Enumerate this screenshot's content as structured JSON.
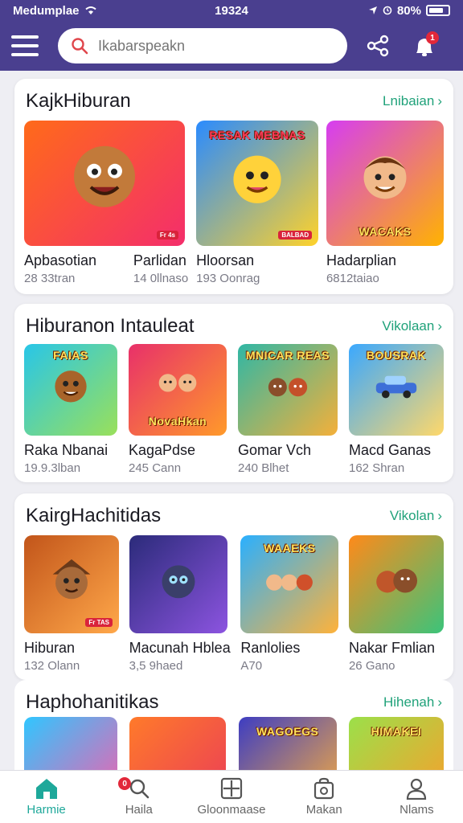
{
  "status_bar": {
    "carrier": "Medumplae",
    "time": "19324",
    "battery": "80%"
  },
  "search": {
    "placeholder": "Ikabarspeakn"
  },
  "top_bar": {
    "notification_count": "1"
  },
  "sections": [
    {
      "title": "KajkHiburan",
      "more": "Lnibaian",
      "cards": [
        {
          "name": "Apbasotian",
          "meta": "28 33tran",
          "thumb_text": "",
          "tag": "Fr 4s",
          "colors": [
            "#ff6a1a",
            "#f42e6b"
          ]
        },
        {
          "name": "Parlidan",
          "meta": "14 0llnaso",
          "thumb_text": "",
          "tag": "",
          "colors": [
            "#ff6a1a",
            "#f42e6b"
          ]
        },
        {
          "name": "Hloorsan",
          "meta": "193 Oonrag",
          "thumb_text": "RESAK MEBNAS",
          "tag": "BALBAD",
          "colors": [
            "#2a8bff",
            "#ffd22a"
          ]
        },
        {
          "name": "Hadarplian",
          "meta": "6812taiao",
          "thumb_text": "WACAKS",
          "tag": "",
          "colors": [
            "#d63df2",
            "#ffb300"
          ]
        }
      ]
    },
    {
      "title": "Hiburanon Intauleat",
      "more": "Vikolaan",
      "cards": [
        {
          "name": "Raka Nbanai",
          "meta": "19.9.3lban",
          "thumb_text": "FAIAS",
          "tag": "",
          "colors": [
            "#28c6e8",
            "#9ae05a"
          ]
        },
        {
          "name": "KagaPdse",
          "meta": "245 Cann",
          "thumb_text": "NovaHkan",
          "tag": "",
          "colors": [
            "#e8306a",
            "#ff9a2a"
          ]
        },
        {
          "name": "Gomar Vch",
          "meta": "240 Blhet",
          "thumb_text": "MNICAR REAS",
          "tag": "",
          "colors": [
            "#2fb7a5",
            "#f4b03a"
          ]
        },
        {
          "name": "Macd Ganas",
          "meta": "162 Shran",
          "thumb_text": "BOUSRAK",
          "tag": "",
          "colors": [
            "#3aa8ff",
            "#ffd86a"
          ]
        }
      ]
    },
    {
      "title": "KairgHachitidas",
      "more": "Vikolan",
      "cards": [
        {
          "name": "Hiburan",
          "meta": "132 Olann",
          "thumb_text": "",
          "tag": "Fr TAS",
          "colors": [
            "#c2551a",
            "#ffa84a"
          ]
        },
        {
          "name": "Macunah Hblea",
          "meta": "3,5 9haed",
          "thumb_text": "",
          "tag": "",
          "colors": [
            "#2b2b7a",
            "#8c54e0"
          ]
        },
        {
          "name": "Ranlolies",
          "meta": "A70",
          "thumb_text": "WAAEKS",
          "tag": "",
          "colors": [
            "#2ab0ff",
            "#ffb23a"
          ]
        },
        {
          "name": "Nakar Fmlian",
          "meta": "26 Gano",
          "thumb_text": "",
          "tag": "",
          "colors": [
            "#ff8a1a",
            "#3bc47a"
          ]
        }
      ]
    },
    {
      "title": "Haphohanitikas",
      "more": "Hihenah",
      "cards": [
        {
          "name": "",
          "meta": "",
          "thumb_text": "",
          "tag": "",
          "colors": [
            "#30c6ff",
            "#ff5aa8"
          ]
        },
        {
          "name": "",
          "meta": "",
          "thumb_text": "",
          "tag": "",
          "colors": [
            "#ff7a2a",
            "#e93a5a"
          ]
        },
        {
          "name": "",
          "meta": "",
          "thumb_text": "WAGOEGS",
          "tag": "",
          "colors": [
            "#3d3dc2",
            "#ffb23a"
          ]
        },
        {
          "name": "",
          "meta": "",
          "thumb_text": "HIMAKEI",
          "tag": "",
          "colors": [
            "#9be04a",
            "#ff9a2a"
          ]
        }
      ]
    }
  ],
  "bottom_nav": [
    {
      "label": "Harmie",
      "icon": "home-icon",
      "active": true,
      "badge": ""
    },
    {
      "label": "Haila",
      "icon": "search-icon",
      "active": false,
      "badge": "0"
    },
    {
      "label": "Gloonmaase",
      "icon": "grid-icon",
      "active": false,
      "badge": ""
    },
    {
      "label": "Makan",
      "icon": "bag-icon",
      "active": false,
      "badge": ""
    },
    {
      "label": "Nlams",
      "icon": "profile-icon",
      "active": false,
      "badge": ""
    }
  ]
}
